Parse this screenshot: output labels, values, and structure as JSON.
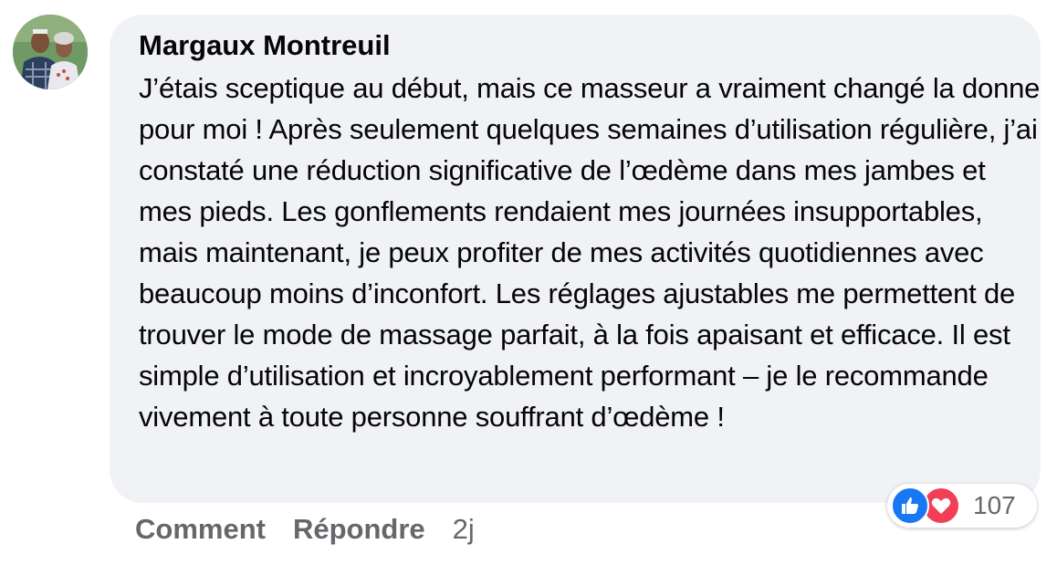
{
  "comment": {
    "author": "Margaux Montreuil",
    "text": "J’étais sceptique au début, mais ce masseur a vraiment changé la donne pour moi ! Après seulement quelques semaines d’utilisation régulière, j’ai constaté une réduction significative de l’œdème dans mes jambes et mes pieds. Les gonflements rendaient mes journées insupportables, mais maintenant, je peux profiter de mes activités quotidiennes avec beaucoup moins d’inconfort. Les réglages ajustables me permettent de trouver le mode de massage parfait, à la fois apaisant et efficace. Il est simple d’utilisation et incroyablement performant – je le recommande vivement à toute personne souffrant d’œdème !",
    "reactions": {
      "icons": [
        "like-icon",
        "love-icon"
      ],
      "count": "107",
      "like_color": "#1877f2",
      "love_color": "#f33e58"
    },
    "actions": {
      "comment_label": "Comment",
      "reply_label": "Répondre",
      "timestamp": "2j"
    }
  },
  "colors": {
    "bubble_bg": "#f0f2f5",
    "secondary_text": "#65676b",
    "primary_text": "#050505"
  }
}
